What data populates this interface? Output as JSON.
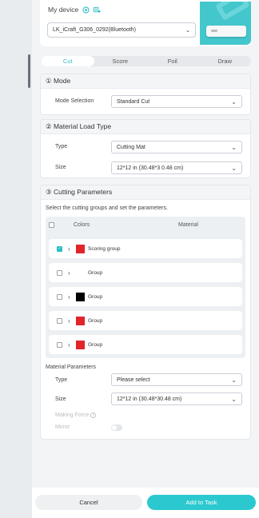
{
  "device": {
    "title": "My device",
    "selected": "LK_iCraft_G306_0292(Bluetooth)"
  },
  "tabs": [
    {
      "label": "Cut",
      "active": true
    },
    {
      "label": "Score",
      "active": false
    },
    {
      "label": "Foil",
      "active": false
    },
    {
      "label": "Draw",
      "active": false
    }
  ],
  "mode": {
    "heading": "① Mode",
    "label": "Mode Selection",
    "value": "Standard Cut"
  },
  "material_load": {
    "heading": "② Material Load Type",
    "type_label": "Type",
    "type_value": "Cutting Mat",
    "size_label": "Size",
    "size_value": "12*12 in (30.48*3 0.48 cm)"
  },
  "cutting": {
    "heading": "③ Cutting Parameters",
    "hint": "Select the cutting groups and set the parameters.",
    "col_colors": "Colors",
    "col_material": "Material",
    "groups": [
      {
        "label": "Scoring group",
        "color": "#e0262b",
        "checked": true
      },
      {
        "label": "Group",
        "color": "",
        "checked": false
      },
      {
        "label": "Group",
        "color": "#000000",
        "checked": false
      },
      {
        "label": "Group",
        "color": "#e0262b",
        "checked": false
      },
      {
        "label": "Group",
        "color": "#e0262b",
        "checked": false
      }
    ],
    "material_params_title": "Material Parameters",
    "type_label": "Type",
    "type_placeholder": "Please select",
    "size_label": "Size",
    "size_value": "12*12 in (30.48*30.48 cm)",
    "making_force_label": "Making Force",
    "mirror_label": "Mirror"
  },
  "footer": {
    "cancel": "Cancel",
    "add": "Add to Task"
  },
  "colors": {
    "accent": "#2bc9cf",
    "red": "#e0262b"
  }
}
